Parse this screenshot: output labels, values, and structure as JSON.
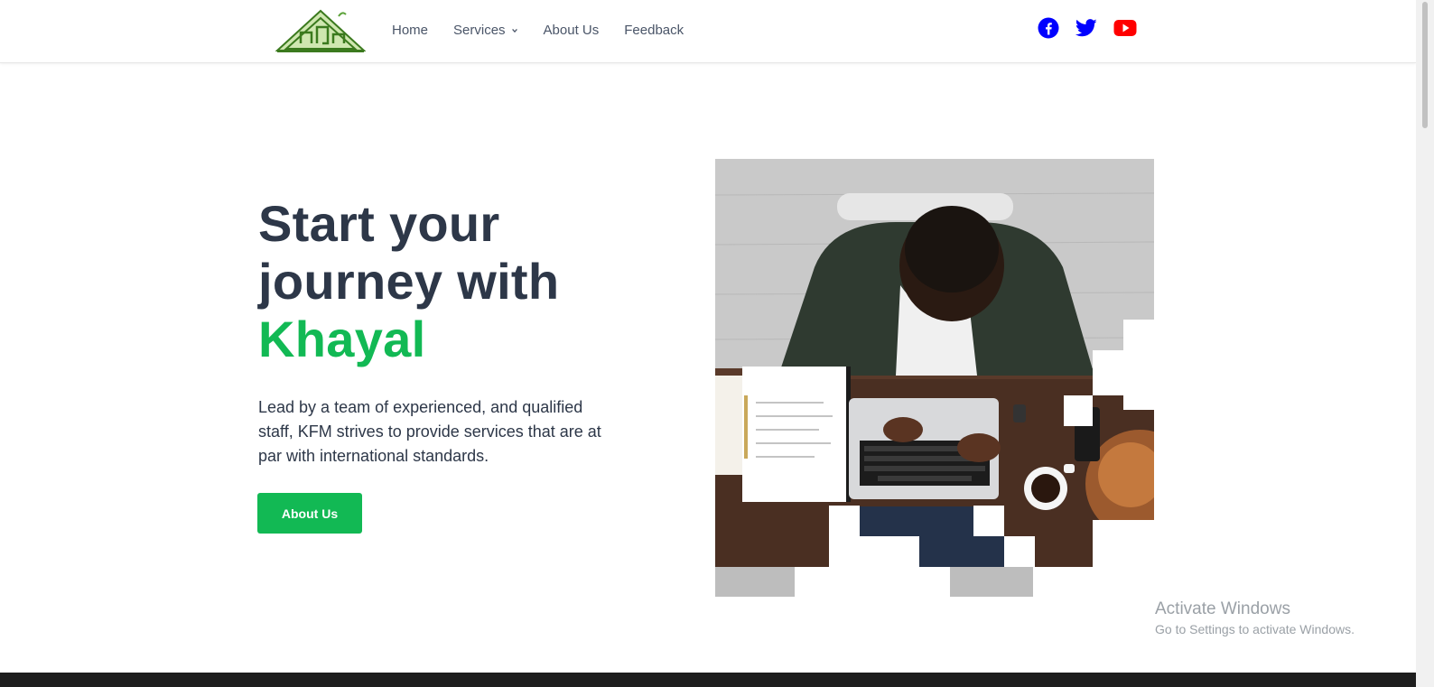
{
  "nav": {
    "items": [
      {
        "label": "Home"
      },
      {
        "label": "Services"
      },
      {
        "label": "About Us"
      },
      {
        "label": "Feedback"
      }
    ]
  },
  "socials": {
    "facebook_color": "#0000ff",
    "twitter_color": "#0000ff",
    "youtube_color": "#ff0000"
  },
  "hero": {
    "title_line1": "Start your",
    "title_line2": "journey with",
    "title_accent": "Khayal",
    "description": "Lead by a team of experienced, and qualified staff, KFM strives to provide services that are at par with international standards.",
    "cta_label": "About Us",
    "accent_color": "#12b954"
  },
  "watermark": {
    "title": "Activate Windows",
    "subtitle": "Go to Settings to activate Windows."
  }
}
